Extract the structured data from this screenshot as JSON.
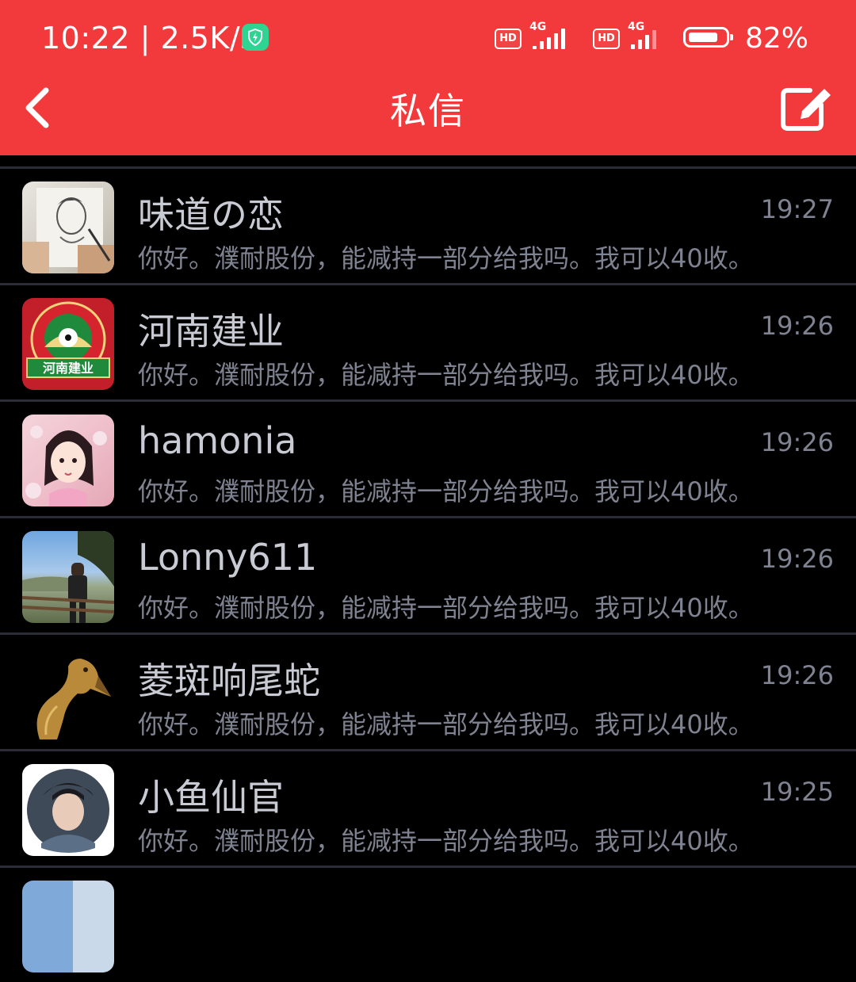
{
  "status_bar": {
    "time": "10:22 | 2.5K/s",
    "hd1": "HD",
    "net1": "4G",
    "hd2": "HD",
    "net2": "4G",
    "battery_level": 0.82,
    "battery_pct": "82%"
  },
  "header": {
    "title": "私信",
    "back_icon": "chevron-left-icon",
    "compose_icon": "edit-icon"
  },
  "colors": {
    "header_bg": "#f23a3c",
    "list_bg": "#000000",
    "divider": "#2a2d36"
  },
  "conversations": [
    {
      "name": "味道の恋",
      "preview": "你好。濮耐股份，能减持一部分给我吗。我可以40收。",
      "time": "19:27",
      "avatar": "pencil-sketch-portrait"
    },
    {
      "name": "河南建业",
      "preview": "你好。濮耐股份，能减持一部分给我吗。我可以40收。",
      "time": "19:26",
      "avatar": "henan-jianye-club-logo",
      "avatar_text": "河南建业"
    },
    {
      "name": "hamonia",
      "preview": "你好。濮耐股份，能减持一部分给我吗。我可以40收。",
      "time": "19:26",
      "avatar": "anime-girl-with-blossoms"
    },
    {
      "name": "Lonny611",
      "preview": "你好。濮耐股份，能减持一部分给我吗。我可以40收。",
      "time": "19:26",
      "avatar": "man-on-mountain-photo"
    },
    {
      "name": "菱斑响尾蛇",
      "preview": "你好。濮耐股份，能减持一部分给我吗。我可以40收。",
      "time": "19:26",
      "avatar": "golden-snake"
    },
    {
      "name": "小鱼仙官",
      "preview": "你好。濮耐股份，能减持一部分给我吗。我可以40收。",
      "time": "19:25",
      "avatar": "round-portrait-photo"
    }
  ]
}
